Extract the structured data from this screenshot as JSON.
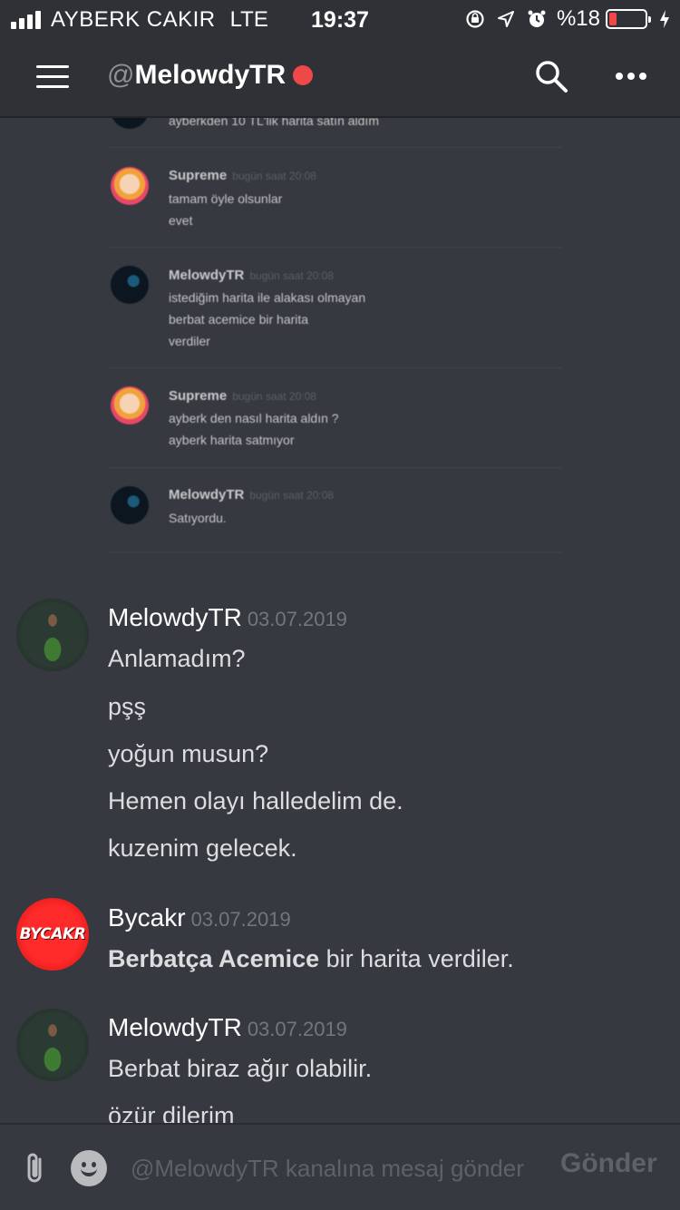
{
  "status_bar": {
    "carrier": "AYBERK CAKIR",
    "network": "LTE",
    "time": "19:37",
    "battery_text": "%18",
    "battery_color": "#f04747",
    "battery_level_percent": 18
  },
  "header": {
    "at_symbol": "@",
    "title": "MelowdyTR",
    "status_color": "#f04747",
    "menu_icon": "hamburger-icon",
    "search_icon": "search-icon",
    "more_icon": "more-icon"
  },
  "embedded_screenshot": {
    "messages": [
      {
        "author": "",
        "time": "",
        "lines": [
          "ayberkden 10 TL'lik harita satın aldım"
        ]
      },
      {
        "author": "Supreme",
        "time": "bugün saat 20:08",
        "lines": [
          "tamam öyle olsunlar",
          "evet"
        ]
      },
      {
        "author": "MelowdyTR",
        "time": "bugün saat 20:08",
        "lines": [
          "istediğim harita ile alakası olmayan",
          "berbat acemice bir harita",
          "verdiler"
        ]
      },
      {
        "author": "Supreme",
        "time": "bugün saat 20:08",
        "lines": [
          "ayberk den nasıl harita aldın ?",
          "ayberk harita satmıyor"
        ]
      },
      {
        "author": "MelowdyTR",
        "time": "bugün saat 20:08",
        "lines": [
          "Satıyordu."
        ]
      }
    ]
  },
  "messages": [
    {
      "author": "MelowdyTR",
      "date": "03.07.2019",
      "lines": [
        "Anlamadım?",
        "pşş",
        "yoğun musun?",
        "Hemen olayı halledelim de.",
        "kuzenim gelecek."
      ]
    },
    {
      "author": "Bycakr",
      "date": "03.07.2019",
      "avatar_text": "BYCAKR",
      "bold_part": "Berbatça Acemice",
      "rest": " bir harita verdiler."
    },
    {
      "author": "MelowdyTR",
      "date": "03.07.2019",
      "lines": [
        "Berbat biraz ağır olabilir.",
        "özür dilerim"
      ]
    }
  ],
  "composer": {
    "placeholder": "@MelowdyTR kanalına mesaj gönder",
    "send_label": "Gönder",
    "attach_icon": "paperclip-icon",
    "emoji_icon": "emoji-icon"
  }
}
